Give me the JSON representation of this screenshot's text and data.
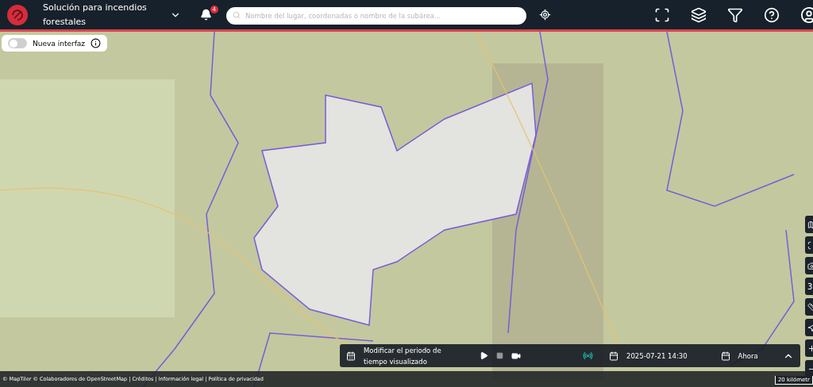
{
  "header": {
    "title": "Solución para incendios forestales",
    "notifications": "4",
    "search_placeholder": "Nombre del lugar, coordenadas o nombre de la subárea..."
  },
  "interface_toggle": {
    "label": "Nueva interfaz",
    "on": false
  },
  "time_bar": {
    "title": "Modificar el periodo de tiempo visualizado",
    "date": "2025-07-21 14:30",
    "now_label": "Ahora",
    "live": true
  },
  "map_controls": [
    {
      "kind": "icon"
    },
    {
      "kind": "icon"
    },
    {
      "kind": "icon"
    },
    {
      "kind": "text",
      "label": "3"
    },
    {
      "kind": "icon"
    },
    {
      "kind": "icon"
    },
    {
      "kind": "zoom-in"
    },
    {
      "kind": "zoom-out"
    }
  ],
  "scale": "20 kilómetr",
  "attribution": "© MapTiler © Colaboradores de OpenStreetMap | Créditos | Información legal | Política de privacidad"
}
